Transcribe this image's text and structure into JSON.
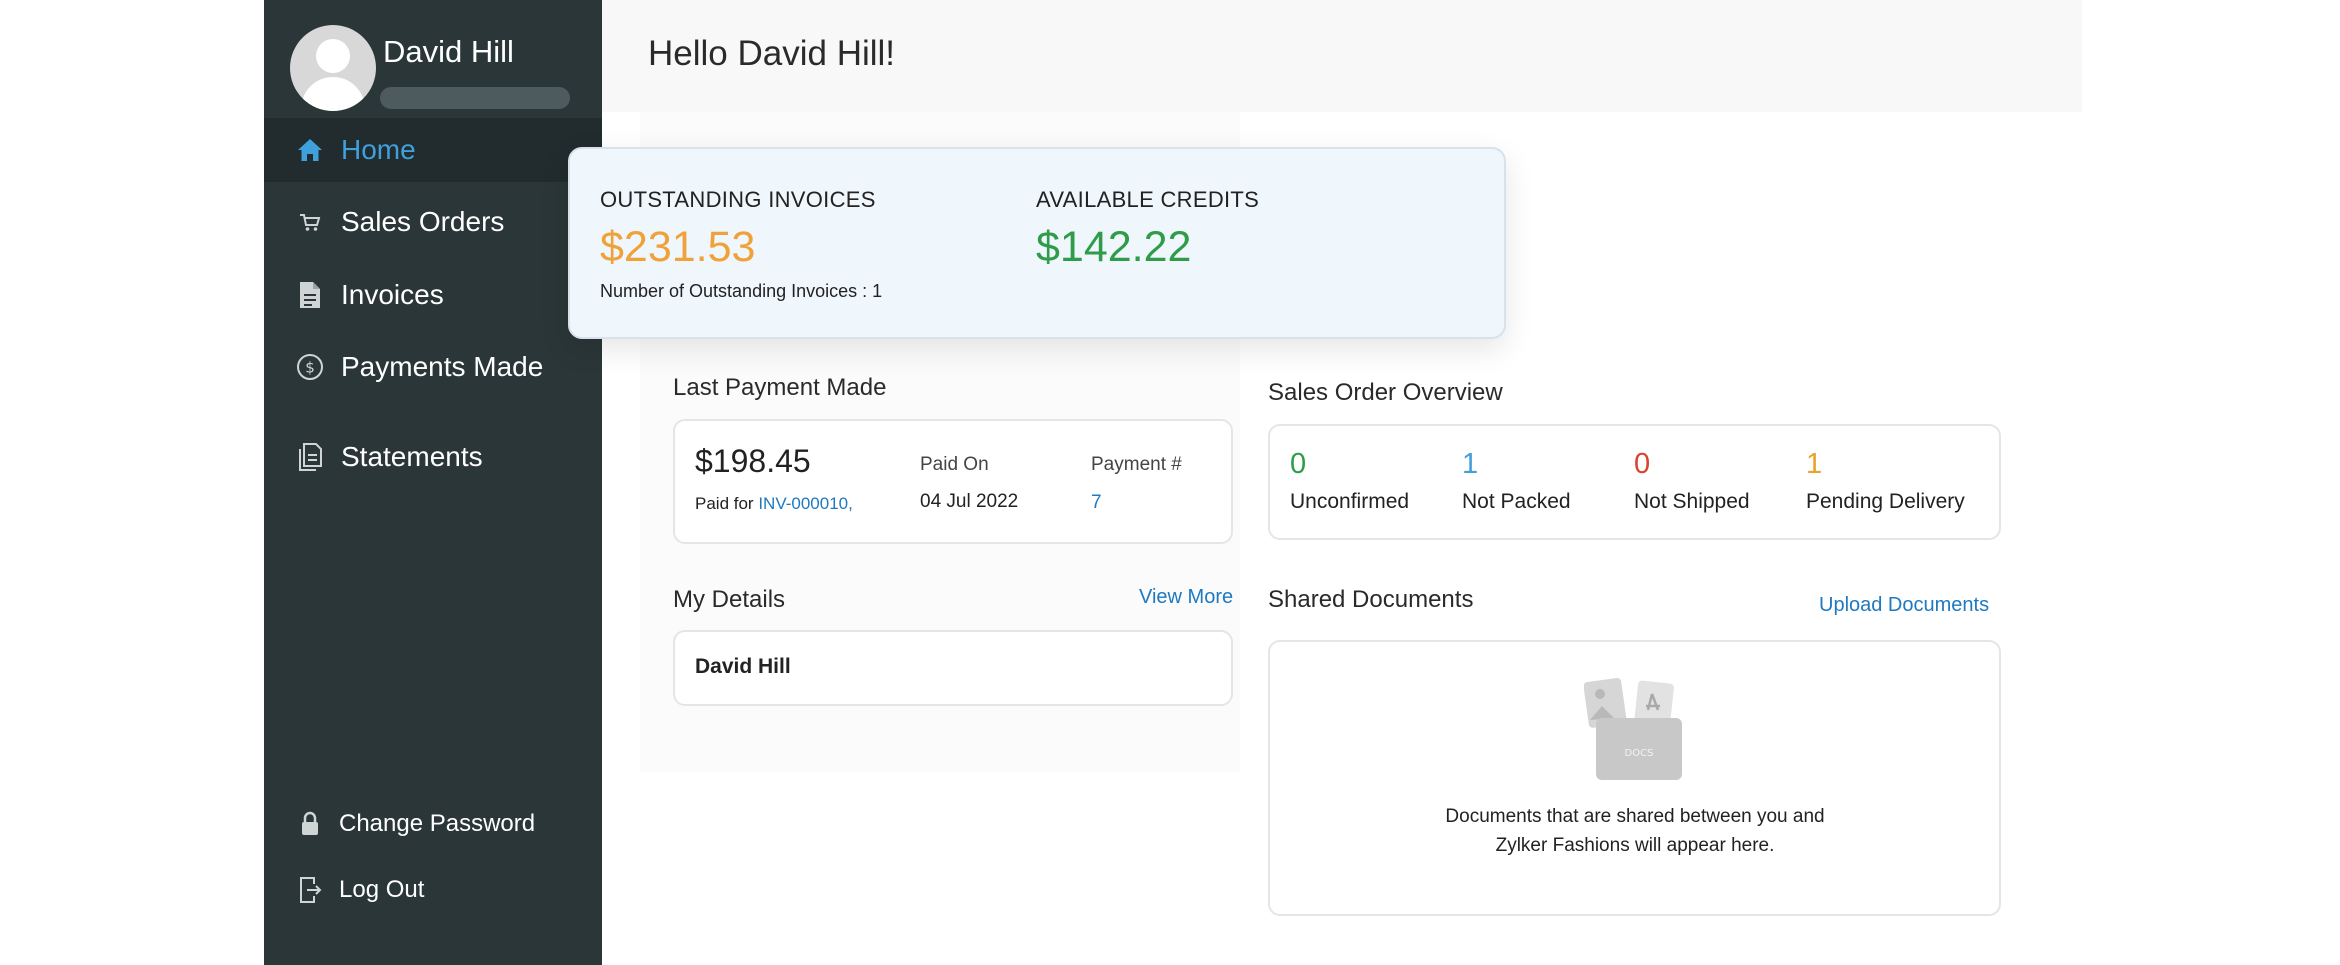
{
  "user": {
    "name": "David Hill"
  },
  "sidebar": {
    "items": [
      {
        "label": "Home",
        "icon": "home-icon",
        "active": true
      },
      {
        "label": "Sales Orders",
        "icon": "cart-icon"
      },
      {
        "label": "Invoices",
        "icon": "document-icon"
      },
      {
        "label": "Payments Made",
        "icon": "dollar-circle-icon"
      },
      {
        "label": "Statements",
        "icon": "statements-icon"
      }
    ],
    "bottom": [
      {
        "label": "Change Password",
        "icon": "lock-icon"
      },
      {
        "label": "Log Out",
        "icon": "logout-icon"
      }
    ]
  },
  "header": {
    "greeting": "Hello David Hill!"
  },
  "summary": {
    "outstanding_title": "OUTSTANDING INVOICES",
    "outstanding_amount": "$231.53",
    "outstanding_note": "Number of Outstanding Invoices : 1",
    "credits_title": "AVAILABLE CREDITS",
    "credits_amount": "$142.22"
  },
  "last_payment": {
    "title": "Last Payment Made",
    "amount": "$198.45",
    "paid_for_prefix": "Paid for",
    "paid_for_invoice": "INV-000010,",
    "paid_on_label": "Paid On",
    "paid_on_value": "04 Jul 2022",
    "payment_no_label": "Payment #",
    "payment_no_value": "7"
  },
  "sales_overview": {
    "title": "Sales Order Overview",
    "stats": [
      {
        "count": "0",
        "label": "Unconfirmed",
        "color": "#2e9c48"
      },
      {
        "count": "1",
        "label": "Not Packed",
        "color": "#3fa0db"
      },
      {
        "count": "0",
        "label": "Not Shipped",
        "color": "#d9432f"
      },
      {
        "count": "1",
        "label": "Pending Delivery",
        "color": "#e8a32a"
      }
    ]
  },
  "my_details": {
    "title": "My Details",
    "view_more": "View More",
    "name": "David Hill"
  },
  "shared_documents": {
    "title": "Shared Documents",
    "upload": "Upload Documents",
    "placeholder_line1": "Documents that are shared between you and",
    "placeholder_line2": "Zylker Fashions will appear here.",
    "illustration_label": "DOCS"
  },
  "colors": {
    "sidebar_bg": "#2b3638",
    "accent_blue": "#3fa0db",
    "outstanding": "#f0a23a",
    "credits": "#2e9c48",
    "link": "#1e79c0"
  }
}
